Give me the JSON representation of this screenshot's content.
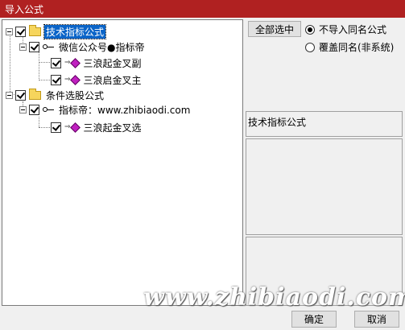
{
  "window": {
    "title": "导入公式"
  },
  "tree": {
    "nodes": [
      {
        "label": "技术指标公式",
        "selected": true
      },
      {
        "label": "微信公众号●指标帝"
      },
      {
        "label": "三浪起金叉副"
      },
      {
        "label": "三浪启金叉主"
      },
      {
        "label": "条件选股公式"
      },
      {
        "label": "指标帝：www.zhibiaodi.com"
      },
      {
        "label": "三浪起金叉选"
      }
    ]
  },
  "options": {
    "select_all_label": "全部选中",
    "radio_options": [
      {
        "label": "不导入同名公式",
        "checked": true
      },
      {
        "label": "覆盖同名(非系统)",
        "checked": false
      }
    ]
  },
  "info": {
    "category": "技术指标公式"
  },
  "buttons": {
    "ok": "确定",
    "cancel": "取消"
  },
  "watermark": "www.zhibiaodi.com",
  "colors": {
    "titlebar": "#b02121",
    "selection": "#0a64c8"
  }
}
